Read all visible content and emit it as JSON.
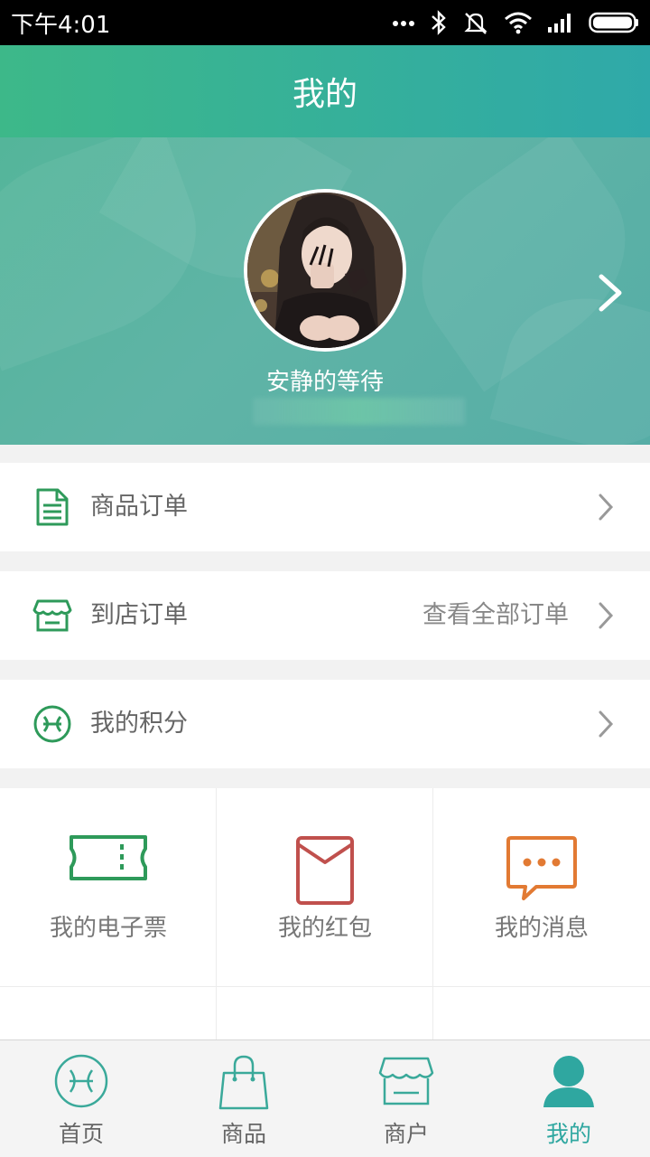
{
  "status_bar": {
    "time": "下午4:01"
  },
  "header": {
    "title": "我的"
  },
  "profile": {
    "nickname": "安静的等待"
  },
  "menu": [
    {
      "label": "商品订单",
      "right_text": "",
      "icon": "document-icon"
    },
    {
      "label": "到店订单",
      "right_text": "查看全部订单",
      "icon": "store-icon"
    },
    {
      "label": "我的积分",
      "right_text": "",
      "icon": "points-icon"
    }
  ],
  "grid": [
    {
      "label": "我的电子票",
      "icon": "ticket-icon",
      "color": "#2e9a5a"
    },
    {
      "label": "我的红包",
      "icon": "red-envelope-icon",
      "color": "#c0504d"
    },
    {
      "label": "我的消息",
      "icon": "message-icon",
      "color": "#e27a33"
    }
  ],
  "tabs": [
    {
      "label": "首页",
      "icon": "home-icon",
      "active": false
    },
    {
      "label": "商品",
      "icon": "shopping-bag-icon",
      "active": false
    },
    {
      "label": "商户",
      "icon": "merchant-icon",
      "active": false
    },
    {
      "label": "我的",
      "icon": "user-icon",
      "active": true
    }
  ],
  "colors": {
    "accent": "#2fa7a0",
    "brand_green": "#2e9a5a",
    "header_start": "#3db889",
    "header_end": "#2fa9a9"
  }
}
